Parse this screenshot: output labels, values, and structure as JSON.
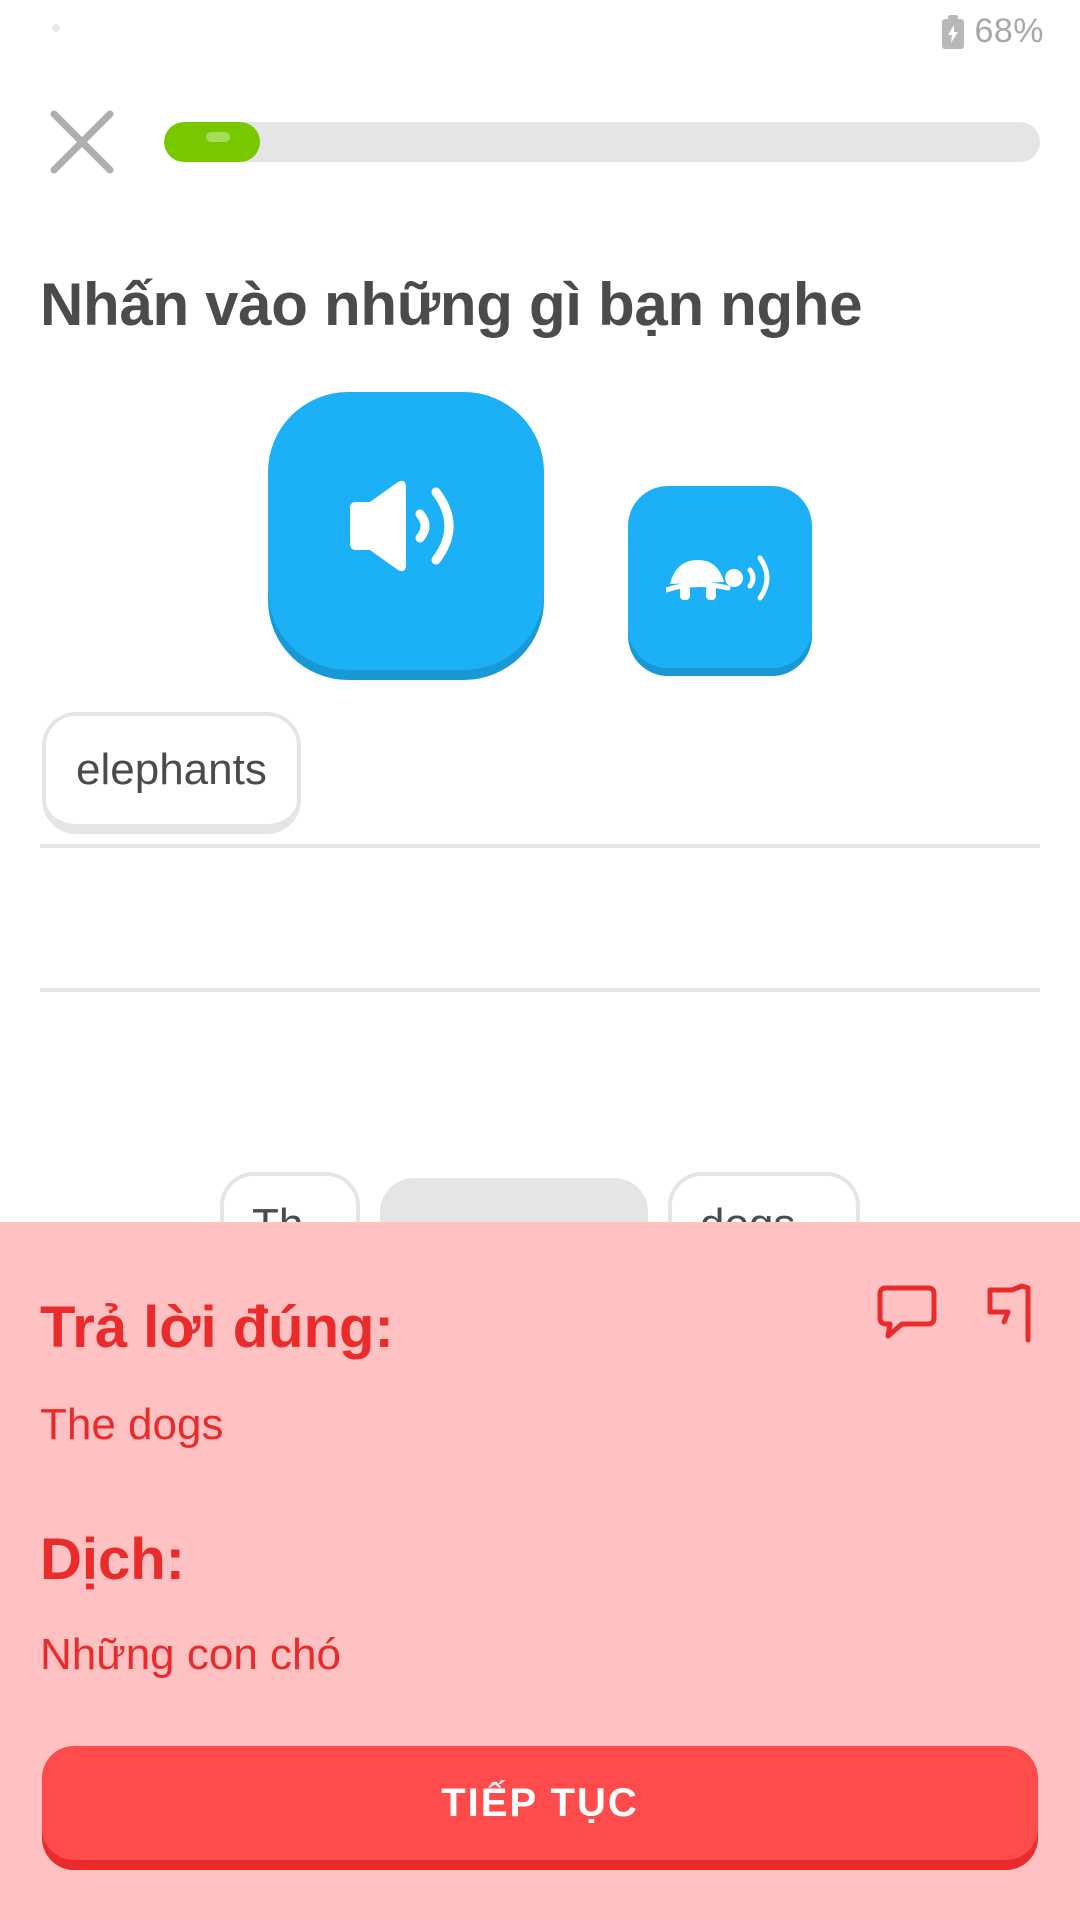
{
  "status_bar": {
    "battery_percent": "68%",
    "battery_icon": "battery-charging-icon"
  },
  "header": {
    "close_icon": "close-icon",
    "progress": 0.11,
    "progress_color": "#78c800"
  },
  "prompt": {
    "title": "Nhấn vào những gì bạn nghe"
  },
  "audio": {
    "play_icon": "speaker-icon",
    "slow_icon": "turtle-speaker-icon",
    "accent_color": "#1cb0f6"
  },
  "answer": {
    "selected_words": [
      "elephants"
    ]
  },
  "word_bank": {
    "chips": [
      {
        "text": "Th"
      },
      {
        "text": "",
        "used": true
      },
      {
        "text": "dogs"
      }
    ]
  },
  "feedback": {
    "heading": "Trả lời đúng:",
    "correct_answer": "The dogs",
    "translation_heading": "Dịch:",
    "translation": "Những con chó",
    "discuss_icon": "comment-icon",
    "report_icon": "flag-icon",
    "continue_label": "TIẾP TỤC",
    "error_color": "#ea2b2b",
    "background_color": "#ffc1c1"
  }
}
